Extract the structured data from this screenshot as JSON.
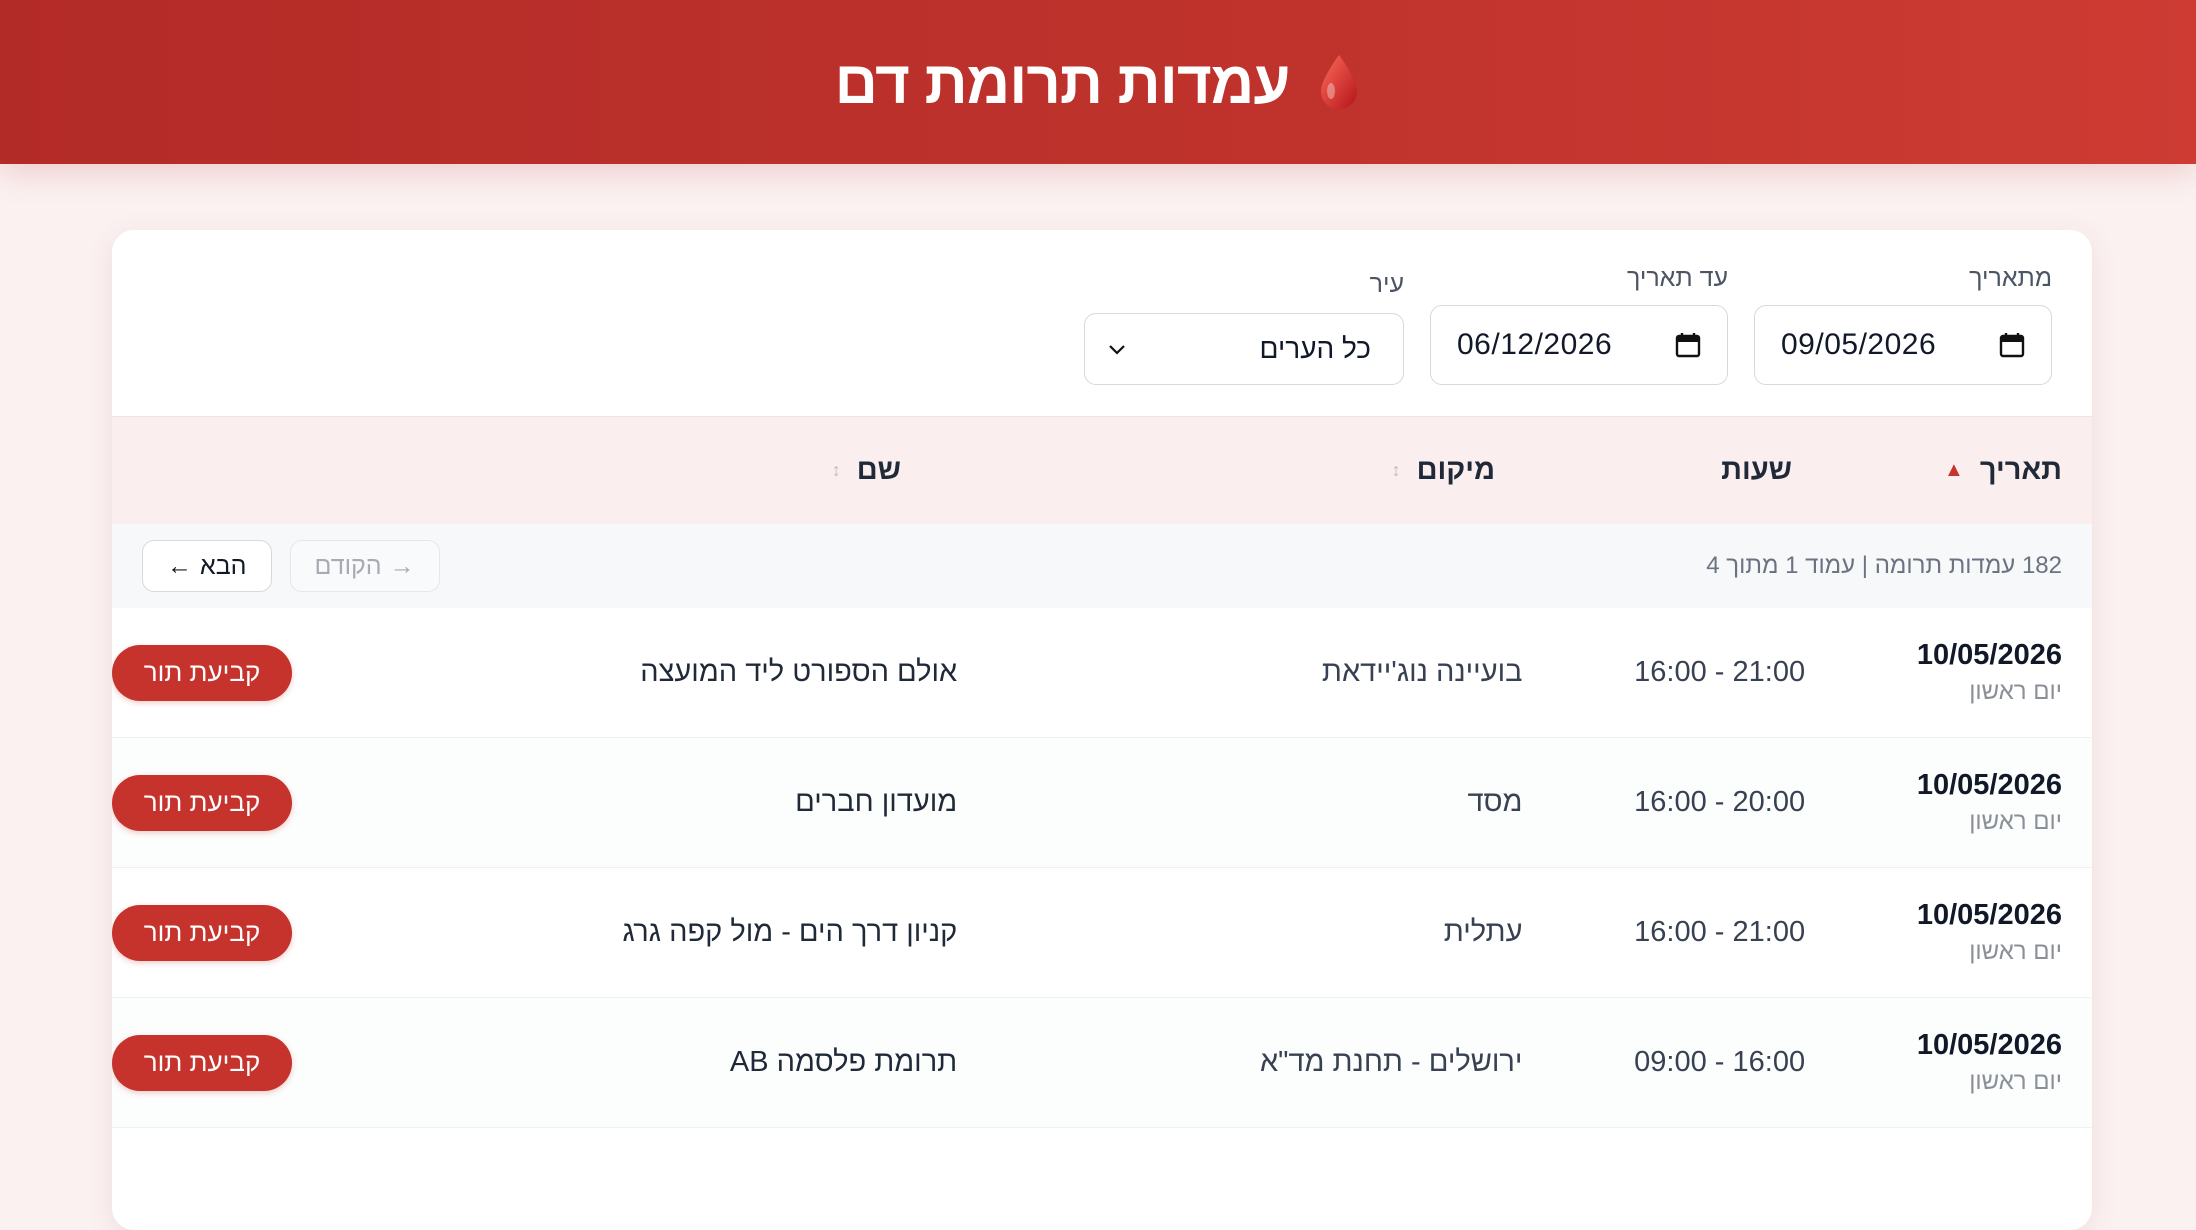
{
  "header": {
    "title": "עמדות תרומת דם",
    "icon": "blood-drop-icon"
  },
  "filters": {
    "from_label": "מתאריך",
    "from_value": "09/05/2026",
    "to_label": "עד תאריך",
    "to_value": "06/12/2026",
    "city_label": "עיר",
    "city_value": "כל הערים"
  },
  "table": {
    "columns": {
      "date": "תאריך",
      "hours": "שעות",
      "location": "מיקום",
      "name": "שם"
    },
    "sort_up": "▲",
    "sort_both": "↕",
    "book_label": "קביעת תור",
    "rows": [
      {
        "date": "10/05/2026",
        "day": "יום ראשון",
        "hours": "16:00 - 21:00",
        "location": "בועיינה נוג'יידאת",
        "name": "אולם הספורט ליד המועצה"
      },
      {
        "date": "10/05/2026",
        "day": "יום ראשון",
        "hours": "16:00 - 20:00",
        "location": "מסד",
        "name": "מועדון חברים"
      },
      {
        "date": "10/05/2026",
        "day": "יום ראשון",
        "hours": "16:00 - 21:00",
        "location": "עתלית",
        "name": "קניון דרך הים - מול קפה גרג"
      },
      {
        "date": "10/05/2026",
        "day": "יום ראשון",
        "hours": "09:00 - 16:00",
        "location": "ירושלים - תחנת מד\"א",
        "name": "תרומת פלסמה AB"
      }
    ]
  },
  "pager": {
    "info": "182 עמדות תרומה | עמוד 1 מתוך 4",
    "prev_label": "הקודם",
    "prev_arrow": "→",
    "next_label": "הבא",
    "next_arrow": "←"
  },
  "colors": {
    "brand": "#c5332c",
    "header_bg": "#b32b27",
    "page_bg": "#fbf1f1"
  }
}
